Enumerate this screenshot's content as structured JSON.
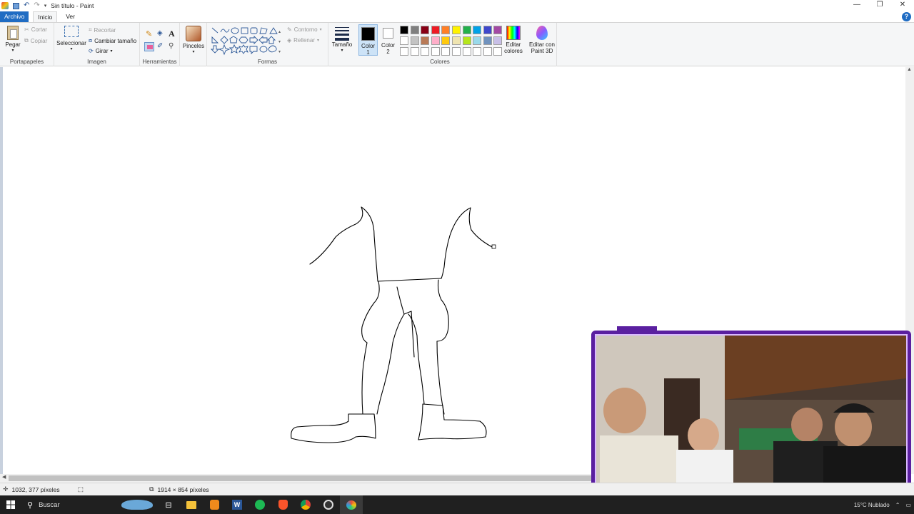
{
  "window": {
    "title": "Sin título - Paint"
  },
  "tabs": [
    {
      "label": "Archivo"
    },
    {
      "label": "Inicio"
    },
    {
      "label": "Ver"
    }
  ],
  "ribbon": {
    "clipboard": {
      "paste": "Pegar",
      "cut": "Cortar",
      "copy": "Copiar",
      "group_label": "Portapapeles"
    },
    "image": {
      "select": "Seleccionar",
      "crop": "Recortar",
      "resize": "Cambiar tamaño",
      "rotate": "Girar",
      "group_label": "Imagen"
    },
    "tools": {
      "group_label": "Herramientas",
      "text_glyph": "A"
    },
    "brushes": {
      "label": "Pinceles"
    },
    "shapes": {
      "outline": "Contorno",
      "fill": "Rellenar",
      "group_label": "Formas"
    },
    "size": {
      "label": "Tamaño"
    },
    "color1": {
      "label_line1": "Color",
      "label_line2": "1"
    },
    "color2": {
      "label_line1": "Color",
      "label_line2": "2"
    },
    "colors": {
      "group_label": "Colores",
      "palette_row1": [
        "#000000",
        "#7f7f7f",
        "#880015",
        "#ed1c24",
        "#ff7f27",
        "#fff200",
        "#22b14c",
        "#00a2e8",
        "#3f48cc",
        "#a349a4"
      ],
      "palette_row2": [
        "#ffffff",
        "#c3c3c3",
        "#b97a57",
        "#ffaec9",
        "#ffc90e",
        "#efe4b0",
        "#b5e61d",
        "#99d9ea",
        "#7092be",
        "#c8bfe7"
      ],
      "palette_row3": [
        "#ffffff",
        "#ffffff",
        "#ffffff",
        "#ffffff",
        "#ffffff",
        "#ffffff",
        "#ffffff",
        "#ffffff",
        "#ffffff",
        "#ffffff"
      ]
    },
    "edit_colors": {
      "line1": "Editar",
      "line2": "colores"
    },
    "paint3d": {
      "line1": "Editar con",
      "line2": "Paint 3D"
    }
  },
  "status": {
    "cursor_pos": "1032, 377 píxeles",
    "image_size": "1914 × 854 píxeles"
  },
  "taskbar": {
    "search_placeholder": "Buscar",
    "weather": "15°C  Nublado"
  },
  "accent": "#1f6cc3",
  "webcam_frame_color": "#5a1fa0"
}
